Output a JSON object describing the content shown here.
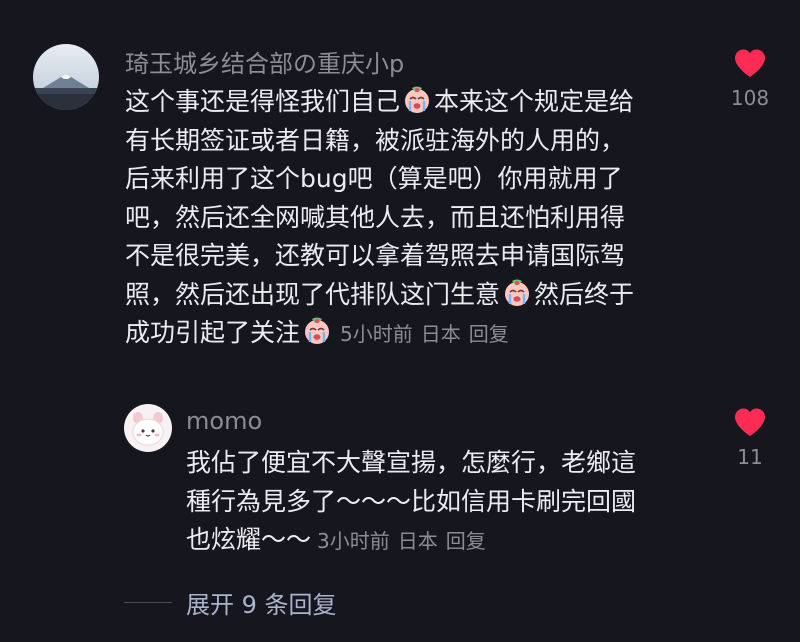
{
  "comment": {
    "username": "琦玉城乡结合部の重庆小p",
    "lines": [
      "这个事还是得怪我们自己",
      "本来这个规定是给",
      "有长期签证或者日籍，被派驻海外的人用的，",
      "后来利用了这个bug吧（算是吧）你用就用了",
      "吧，然后还全网喊其他人去，而且还怕利用得",
      "不是很完美，还教可以拿着驾照去申请国际驾",
      "照，然后还出现了代排队这门生意",
      "然后终于",
      "成功引起了关注"
    ],
    "time": "5小时前",
    "location": "日本",
    "reply_label": "回复",
    "like_count": "108"
  },
  "reply": {
    "username": "momo",
    "lines": [
      "我佔了便宜不大聲宣揚，怎麼行，老鄉這",
      "種行為見多了～～～比如信用卡刷完回國",
      "也炫耀～～"
    ],
    "time": "3小时前",
    "location": "日本",
    "reply_label": "回复",
    "like_count": "11"
  },
  "expand": {
    "label": "展开 9 条回复"
  },
  "colors": {
    "background": "#16161e",
    "text": "#ececf0",
    "muted": "#8c8c93",
    "heart": "#fe2c55",
    "link": "#aab4cf"
  },
  "icons": {
    "like": "heart-icon",
    "emoji": "crying-face-emoji"
  }
}
